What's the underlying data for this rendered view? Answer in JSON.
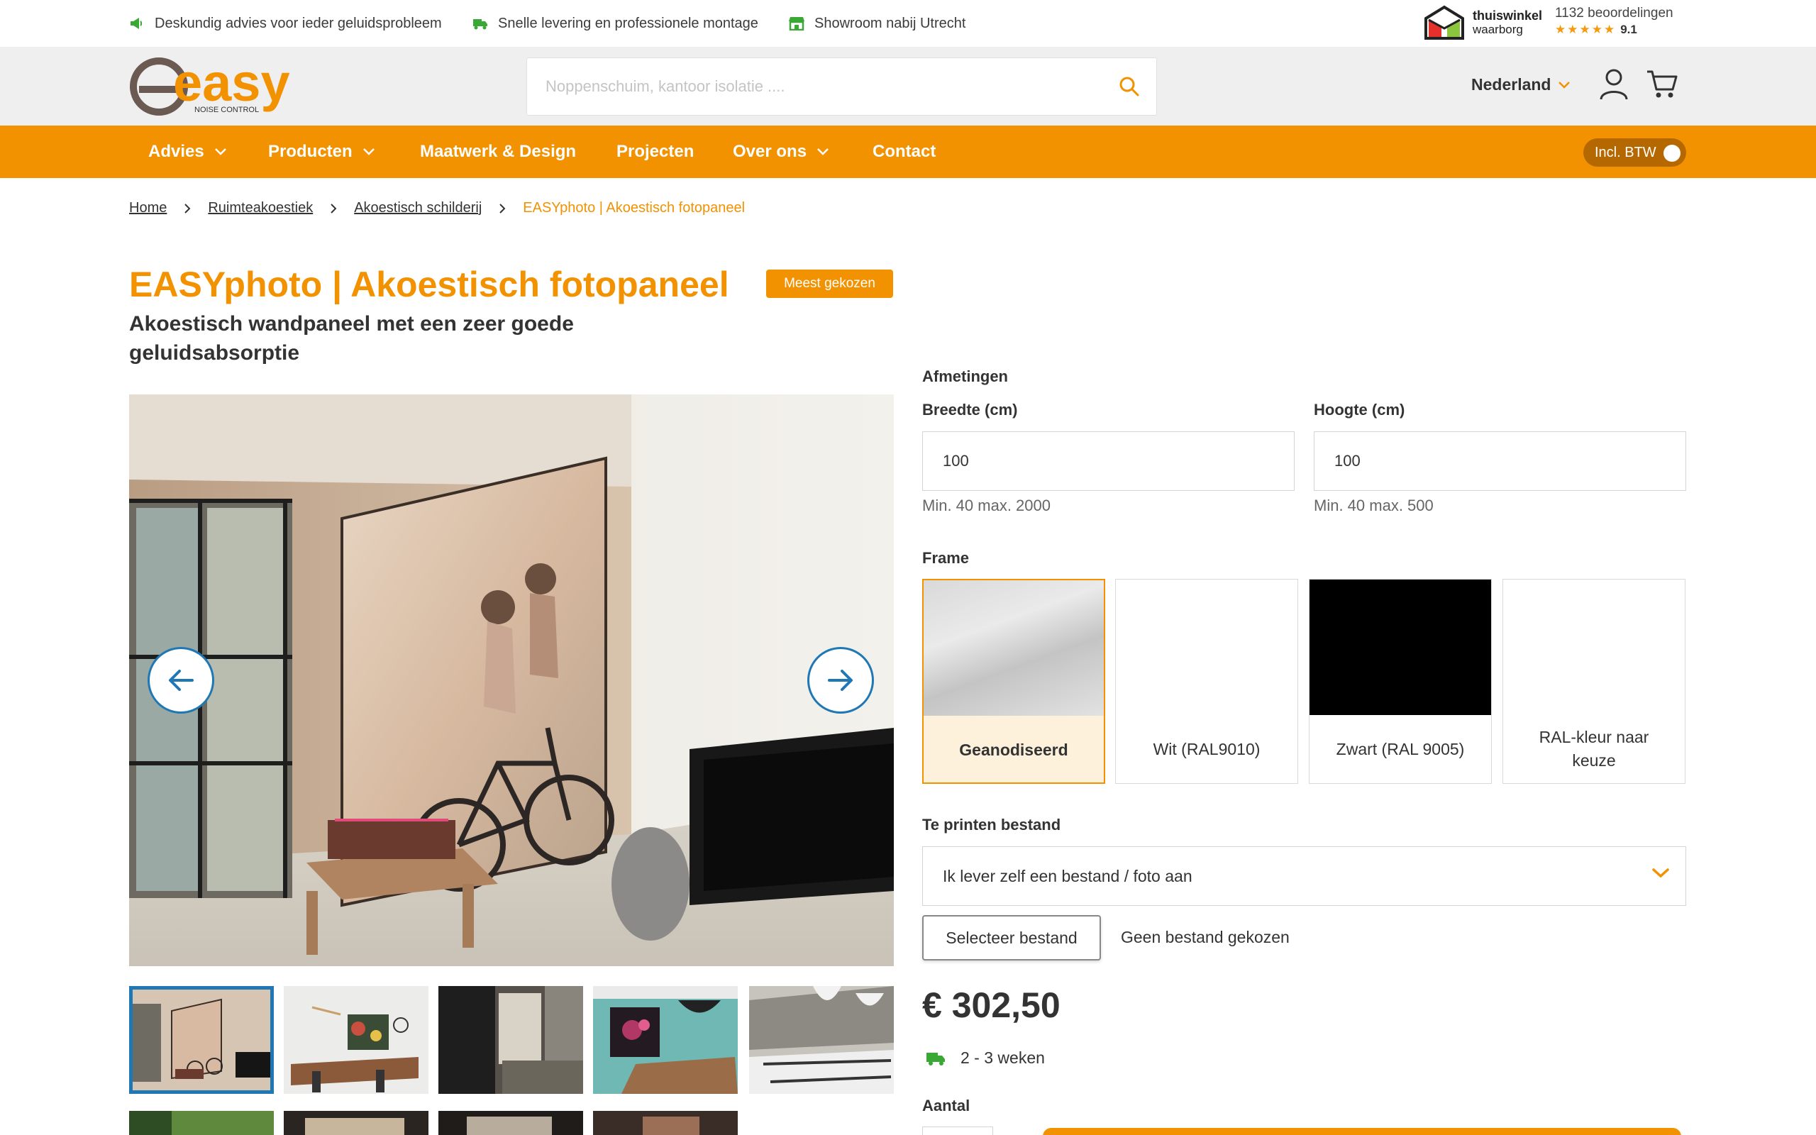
{
  "usp": [
    {
      "icon": "megaphone-icon",
      "text": "Deskundig advies voor ieder geluidsprobleem"
    },
    {
      "icon": "delivery-truck-icon",
      "text": "Snelle levering en professionele montage"
    },
    {
      "icon": "store-icon",
      "text": "Showroom nabij Utrecht"
    }
  ],
  "trust": {
    "name_bold": "thuiswinkel",
    "name_sub": "waarborg",
    "reviews": "1132 beoordelingen",
    "stars": "★★★★★",
    "rating": "9.1"
  },
  "header": {
    "logo_text": "easy",
    "logo_sub": "NOISE CONTROL",
    "search_placeholder": "Noppenschuim, kantoor isolatie ....",
    "country": "Nederland"
  },
  "nav": {
    "items": [
      {
        "label": "Advies",
        "dropdown": true
      },
      {
        "label": "Producten",
        "dropdown": true
      },
      {
        "label": "Maatwerk & Design",
        "dropdown": false
      },
      {
        "label": "Projecten",
        "dropdown": false
      },
      {
        "label": "Over ons",
        "dropdown": true
      },
      {
        "label": "Contact",
        "dropdown": false
      }
    ],
    "vat_toggle": "Incl. BTW"
  },
  "breadcrumb": [
    "Home",
    "Ruimteakoestiek",
    "Akoestisch schilderij",
    "EASYphoto | Akoestisch fotopaneel"
  ],
  "product": {
    "title": "EASYphoto | Akoestisch fotopaneel",
    "badge": "Meest gekozen",
    "subtitle": "Akoestisch wandpaneel met een zeer goede geluidsabsorptie"
  },
  "config": {
    "dimensions_label": "Afmetingen",
    "width": {
      "label": "Breedte (cm)",
      "value": "100",
      "hint": "Min. 40 max. 2000"
    },
    "height": {
      "label": "Hoogte (cm)",
      "value": "100",
      "hint": "Min. 40 max. 500"
    },
    "frame_label": "Frame",
    "frames": [
      {
        "label": "Geanodiseerd",
        "selected": true
      },
      {
        "label": "Wit (RAL9010)",
        "selected": false
      },
      {
        "label": "Zwart (RAL 9005)",
        "selected": false
      },
      {
        "label": "RAL-kleur naar keuze",
        "selected": false
      }
    ],
    "file_label": "Te printen bestand",
    "file_option": "Ik lever zelf een bestand / foto aan",
    "file_button": "Selecteer bestand",
    "file_status": "Geen bestand gekozen",
    "price": "€ 302,50",
    "delivery": "2 - 3 weken",
    "quantity_label": "Aantal"
  },
  "colors": {
    "brand_orange": "#f39200",
    "link_blue": "#1f78b4",
    "header_gray": "#efefef"
  }
}
